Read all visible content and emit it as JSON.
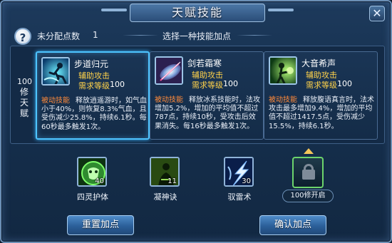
{
  "window": {
    "title": "天赋技能",
    "close_icon": "close-icon"
  },
  "header": {
    "help_glyph": "?",
    "unallocated_label": "未分配点数",
    "unallocated_count": "1",
    "hint": "选择一种技能加点"
  },
  "tier": {
    "level": "100",
    "chars": [
      "修",
      "天",
      "赋"
    ]
  },
  "talents": [
    {
      "name": "步道归元",
      "type": "辅助攻击",
      "req_label": "需求等级",
      "req_value": "100",
      "tag": "被动技能",
      "desc": "释放逍遥游时，如气血小于40%，则恢复8.3%气血，且受伤减少25.8%，持续6.1秒。每60秒最多触发1次。",
      "icon": "runner-icon",
      "selected": true
    },
    {
      "name": "剑若霜寒",
      "type": "辅助攻击",
      "req_label": "需求等级",
      "req_value": "100",
      "tag": "被动技能",
      "desc": "释放冰系技能时，法攻增加5.2%，增加的平均值不超过787点，持续10秒，受攻击后效果消失。每16秒最多触发1次。",
      "icon": "frost-sword-icon",
      "selected": false
    },
    {
      "name": "大音希声",
      "type": "辅助攻击",
      "req_label": "需求等级",
      "req_value": "100",
      "tag": "被动技能",
      "desc": "释放腹语真言时，法术攻击最多增加9.4%，增加的平均值不超过1417.5点，受伤减少15.5%，持续6.1秒。",
      "icon": "meditation-icon",
      "selected": false
    }
  ],
  "skills": [
    {
      "name": "四灵护体",
      "count": "40",
      "icon": "guardian-mask-icon"
    },
    {
      "name": "凝神诀",
      "count": "11",
      "icon": "focus-monk-icon"
    },
    {
      "name": "驭雷术",
      "count": "30",
      "icon": "lightning-icon"
    }
  ],
  "locked_slot": {
    "label": "100修开启",
    "icon": "lock-icon"
  },
  "buttons": {
    "reset": "重置加点",
    "confirm": "确认加点"
  },
  "colors": {
    "selected_border": "#4ec4ff",
    "skill_type": "#ffd24a",
    "passive_tag": "#ff8a3a"
  }
}
